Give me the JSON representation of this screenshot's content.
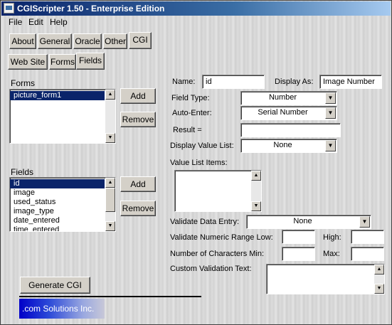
{
  "window": {
    "title": "CGIScripter 1.50 - Enterprise Edition"
  },
  "menu": {
    "file": "File",
    "edit": "Edit",
    "help": "Help"
  },
  "tabs_main": {
    "about": "About",
    "general": "General",
    "oracle": "Oracle",
    "other": "Other",
    "cgi": "CGI"
  },
  "tabs_sub": {
    "website": "Web Site",
    "forms": "Forms",
    "fields": "Fields"
  },
  "forms_section": {
    "label": "Forms",
    "items": [
      "picture_form1"
    ],
    "add_label": "Add",
    "remove_label": "Remove"
  },
  "fields_section": {
    "label": "Fields",
    "items": [
      "id",
      "image",
      "used_status",
      "image_type",
      "date_entered",
      "time_entered"
    ],
    "add_label": "Add",
    "remove_label": "Remove"
  },
  "props": {
    "name_label": "Name:",
    "name_value": "id",
    "display_as_label": "Display As:",
    "display_as_value": "Image Number",
    "field_type_label": "Field Type:",
    "field_type_value": "Number",
    "auto_enter_label": "Auto-Enter:",
    "auto_enter_value": "Serial Number",
    "result_label": "Result =",
    "result_value": "",
    "display_value_list_label": "Display Value List:",
    "display_value_list_value": "None",
    "value_list_items_label": "Value List Items:",
    "validate_data_entry_label": "Validate Data Entry:",
    "validate_data_entry_value": "None",
    "validate_numeric_label": "Validate Numeric Range Low:",
    "high_label": "High:",
    "num_chars_label": "Number of Characters Min:",
    "max_label": "Max:",
    "custom_validation_label": "Custom Validation Text:"
  },
  "generate_label": "Generate CGI",
  "brand": ".com Solutions Inc."
}
